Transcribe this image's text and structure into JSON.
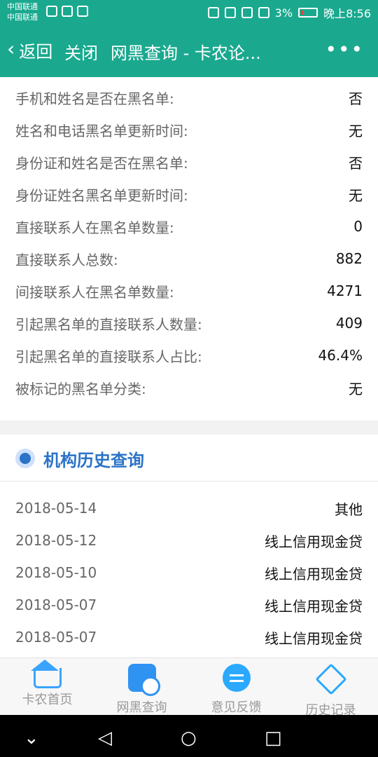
{
  "status_bar": {
    "carrier_1": "中国联通",
    "carrier_2": "中国联通",
    "battery": "3%",
    "time": "晚上8:56"
  },
  "app_bar": {
    "back_label": "返回",
    "close_label": "关闭",
    "title": "网黑查询 - 卡农论...",
    "more_label": "•••"
  },
  "blacklist_info": [
    {
      "label": "手机和姓名是否在黑名单:",
      "value": "否"
    },
    {
      "label": "姓名和电话黑名单更新时间:",
      "value": "无"
    },
    {
      "label": "身份证和姓名是否在黑名单:",
      "value": "否"
    },
    {
      "label": "身份证姓名黑名单更新时间:",
      "value": "无"
    },
    {
      "label": "直接联系人在黑名单数量:",
      "value": "0"
    },
    {
      "label": "直接联系人总数:",
      "value": "882"
    },
    {
      "label": "间接联系人在黑名单数量:",
      "value": "4271"
    },
    {
      "label": "引起黑名单的直接联系人数量:",
      "value": "409"
    },
    {
      "label": "引起黑名单的直接联系人占比:",
      "value": "46.4%"
    },
    {
      "label": "被标记的黑名单分类:",
      "value": "无"
    }
  ],
  "history_section": {
    "title": "机构历史查询",
    "rows": [
      {
        "date": "2018-05-14",
        "type": "其他"
      },
      {
        "date": "2018-05-12",
        "type": "线上信用现金贷"
      },
      {
        "date": "2018-05-10",
        "type": "线上信用现金贷"
      },
      {
        "date": "2018-05-07",
        "type": "线上信用现金贷"
      },
      {
        "date": "2018-05-07",
        "type": "线上信用现金贷"
      }
    ]
  },
  "tab_bar": {
    "tabs": [
      {
        "label": "卡农首页",
        "icon": "home-icon"
      },
      {
        "label": "网黑查询",
        "icon": "search-doc-icon"
      },
      {
        "label": "意见反馈",
        "icon": "feedback-icon"
      },
      {
        "label": "历史记录",
        "icon": "layers-icon"
      }
    ]
  },
  "nav_bar": {
    "icons": [
      "chevron-down-icon",
      "back-triangle-icon",
      "home-circle-icon",
      "recents-square-icon"
    ]
  }
}
